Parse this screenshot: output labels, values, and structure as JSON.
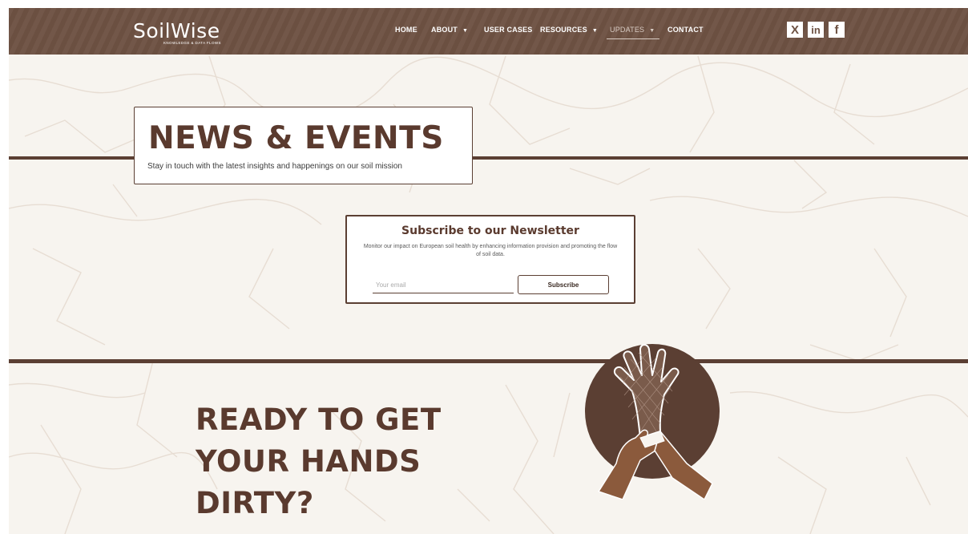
{
  "brand": {
    "name": "SoilWise",
    "tagline": "KNOWLEDGE & DATA FLOWS"
  },
  "nav": {
    "items": [
      {
        "label": "HOME",
        "has_dropdown": false,
        "active": false
      },
      {
        "label": "ABOUT",
        "has_dropdown": true,
        "active": false
      },
      {
        "label": "USER CASES",
        "has_dropdown": false,
        "active": false
      },
      {
        "label": "RESOURCES",
        "has_dropdown": true,
        "active": false
      },
      {
        "label": "UPDATES",
        "has_dropdown": true,
        "active": true
      },
      {
        "label": "CONTACT",
        "has_dropdown": false,
        "active": false
      }
    ],
    "social": [
      {
        "icon": "x-icon",
        "glyph": "X"
      },
      {
        "icon": "linkedin-icon",
        "glyph": "in"
      },
      {
        "icon": "facebook-icon",
        "glyph": "f"
      }
    ]
  },
  "hero": {
    "title": "NEWS & EVENTS",
    "subtitle": "Stay in touch with the latest insights and happenings on our soil mission"
  },
  "newsletter": {
    "title": "Subscribe to our Newsletter",
    "description": "Monitor our impact on European soil health by enhancing information provision and promoting the flow of soil data.",
    "email_placeholder": "Your email",
    "email_value": "",
    "button_label": "Subscribe"
  },
  "cta": {
    "title": "READY TO GET YOUR HANDS DIRTY?"
  },
  "colors": {
    "nav_bg": "#6e5243",
    "accent_dark": "#5a3a2e",
    "page_bg": "#f7f4ef",
    "text_light": "#ffffff"
  }
}
